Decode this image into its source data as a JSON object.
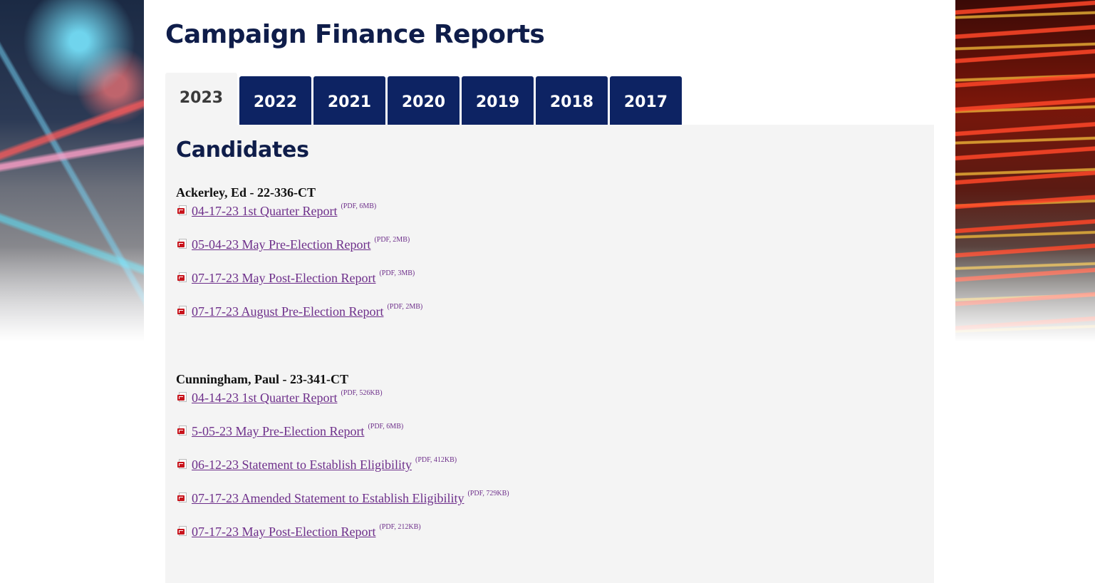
{
  "page_title": "Campaign Finance Reports",
  "tabs": [
    {
      "label": "2023",
      "active": true
    },
    {
      "label": "2022",
      "active": false
    },
    {
      "label": "2021",
      "active": false
    },
    {
      "label": "2020",
      "active": false
    },
    {
      "label": "2019",
      "active": false
    },
    {
      "label": "2018",
      "active": false
    },
    {
      "label": "2017",
      "active": false
    }
  ],
  "section_heading": "Candidates",
  "candidates": [
    {
      "name": "Ackerley, Ed - 22-336-CT",
      "reports": [
        {
          "label": "04-17-23 1st Quarter Report",
          "info": "(PDF, 6MB)"
        },
        {
          "label": "05-04-23 May Pre-Election Report",
          "info": "(PDF, 2MB)"
        },
        {
          "label": "07-17-23 May Post-Election Report",
          "info": "(PDF, 3MB)"
        },
        {
          "label": "07-17-23 August Pre-Election Report",
          "info": "(PDF, 2MB)"
        }
      ]
    },
    {
      "name": "Cunningham, Paul - 23-341-CT",
      "reports": [
        {
          "label": "04-14-23 1st Quarter Report",
          "info": "(PDF, 526KB)"
        },
        {
          "label": "5-05-23 May Pre-Election Report",
          "info": "(PDF, 6MB)"
        },
        {
          "label": "06-12-23 Statement to Establish Eligibility",
          "info": "(PDF, 412KB)"
        },
        {
          "label": "07-17-23 Amended Statement to Establish Eligibility",
          "info": "(PDF, 729KB)"
        },
        {
          "label": "07-17-23 May Post-Election Report",
          "info": "(PDF, 212KB)"
        }
      ]
    }
  ],
  "colors": {
    "navy": "#0d2363",
    "title": "#0f1d4a",
    "link": "#6d2e8a",
    "panel_bg": "#f4f4f4",
    "pdf_red": "#c8141c"
  },
  "icons": {
    "pdf": "pdf-file-icon"
  }
}
